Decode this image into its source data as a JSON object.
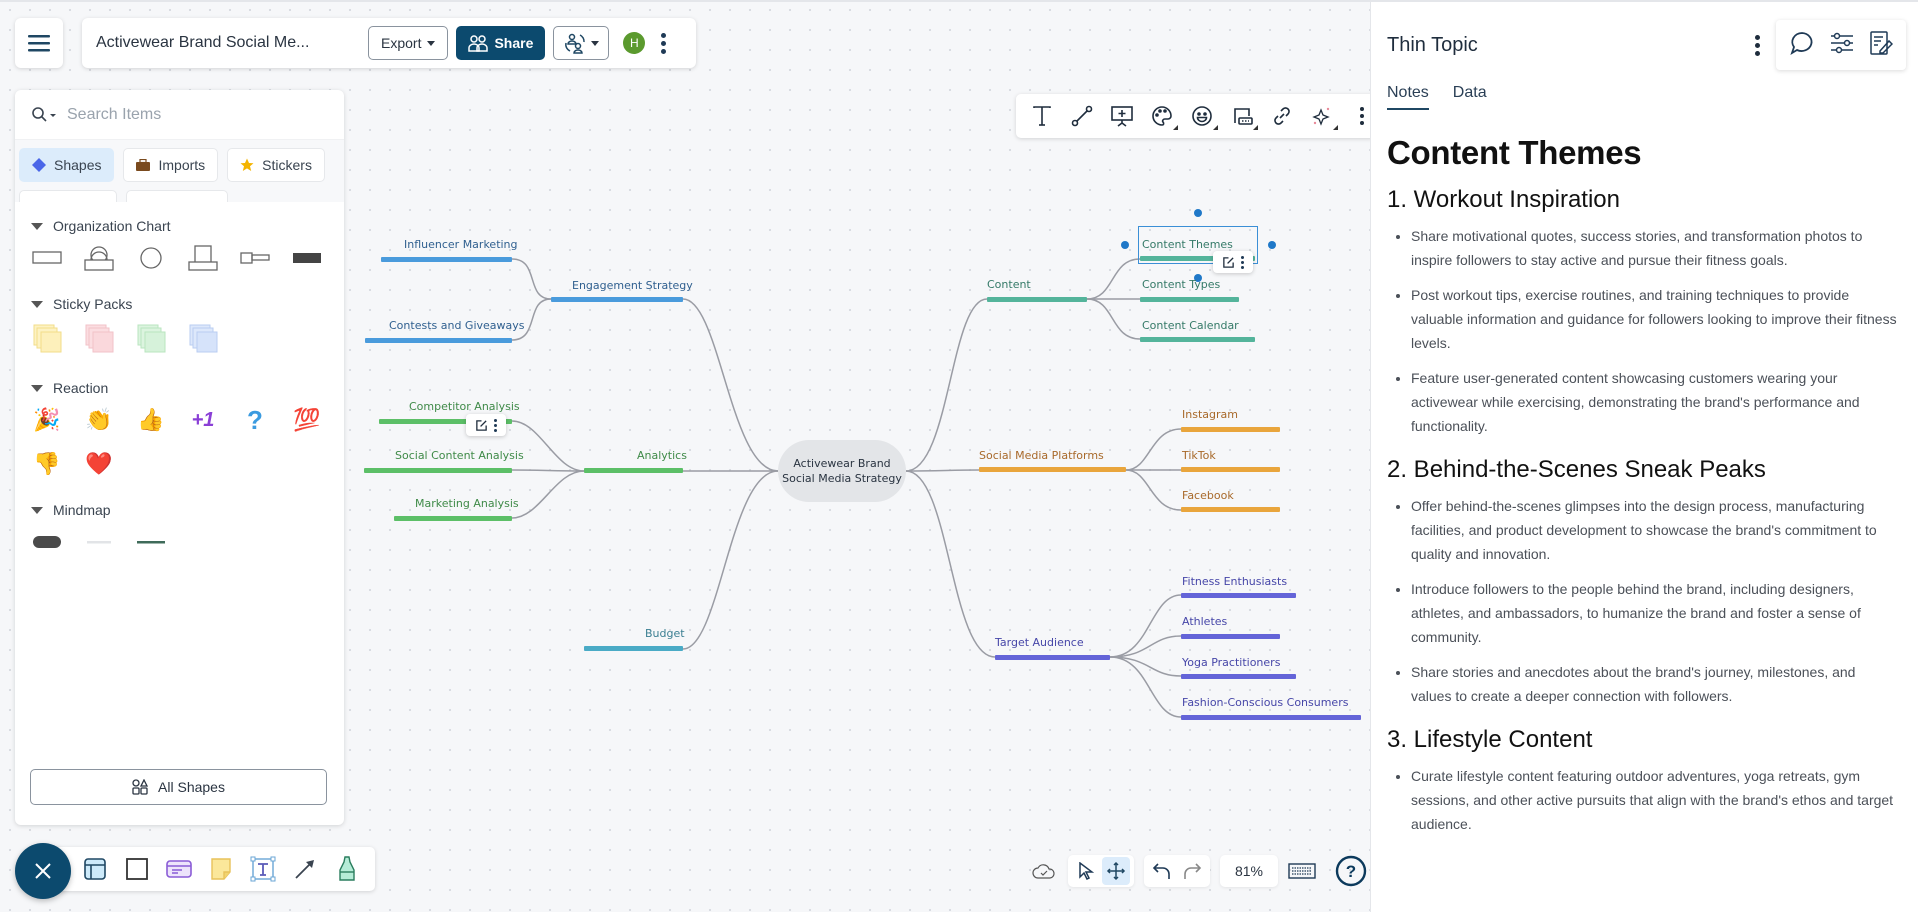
{
  "header": {
    "menu_icon": "hamburger-icon",
    "doc_title": "Activewear Brand Social Me...",
    "export_label": "Export",
    "share_label": "Share",
    "avatar_initial": "H",
    "colors": {
      "primary": "#0c4a6e",
      "avatar": "#5b9a2e"
    }
  },
  "shapes_panel": {
    "search_placeholder": "Search Items",
    "tabs": [
      {
        "label": "Shapes",
        "icon": "diamond-icon",
        "active": true
      },
      {
        "label": "Imports",
        "icon": "briefcase-icon",
        "active": false
      },
      {
        "label": "Stickers",
        "icon": "star-icon",
        "active": false
      }
    ],
    "sections": [
      {
        "title": "Organization Chart",
        "items": [
          "rectangle",
          "person-card",
          "circle",
          "photo-card",
          "label-bar",
          "filled-bar"
        ]
      },
      {
        "title": "Sticky Packs",
        "items": [
          "yellow-pack",
          "pink-pack",
          "green-pack",
          "blue-pack"
        ]
      },
      {
        "title": "Reaction",
        "items": [
          "🎉",
          "👏",
          "👍",
          "+1",
          "❓",
          "💯",
          "👎",
          "❤️"
        ]
      },
      {
        "title": "Mindmap",
        "items": [
          "pill-topic",
          "thin-topic-light",
          "thin-topic-dark"
        ]
      }
    ],
    "all_shapes_label": "All Shapes"
  },
  "canvas_toolbar": {
    "tools": [
      "text",
      "connector",
      "presentation",
      "color-palette",
      "emoji",
      "embed",
      "link",
      "ai-sparkle",
      "more"
    ]
  },
  "create_bar": {
    "tools": [
      "container",
      "rectangle",
      "card",
      "sticky-note",
      "text-box",
      "arrow",
      "highlighter"
    ]
  },
  "bottom_controls": {
    "zoom_level": "81%"
  },
  "mindmap": {
    "root": {
      "line1": "Activewear Brand",
      "line2": "Social Media Strategy"
    },
    "branches": [
      {
        "label": "Engagement Strategy",
        "color": "#4a9bdc",
        "children": [
          "Influencer Marketing",
          "Contests and Giveaways"
        ]
      },
      {
        "label": "Analytics",
        "color": "#5cbf67",
        "children": [
          "Competitor Analysis",
          "Social Content Analysis",
          "Marketing Analysis"
        ]
      },
      {
        "label": "Budget",
        "color": "#4aabc6",
        "children": []
      },
      {
        "label": "Content",
        "color": "#54b49b",
        "children": [
          "Content Themes",
          "Content Types",
          "Content Calendar"
        ]
      },
      {
        "label": "Social Media Platforms",
        "color": "#e9a53c",
        "children": [
          "Instagram",
          "TikTok",
          "Facebook"
        ]
      },
      {
        "label": "Target Audience",
        "color": "#6464d8",
        "children": [
          "Fitness Enthusiasts",
          "Athletes",
          "Yoga Practitioners",
          "Fashion-Conscious Consumers"
        ]
      }
    ],
    "selected_node": "Content Themes"
  },
  "right_panel": {
    "title": "Thin Topic",
    "tabs": [
      {
        "label": "Notes",
        "active": true
      },
      {
        "label": "Data",
        "active": false
      }
    ],
    "notes": {
      "heading": "Content Themes",
      "sections": [
        {
          "title": "1. Workout Inspiration",
          "bullets": [
            "Share motivational quotes, success stories, and transformation photos to inspire followers to stay active and pursue their fitness goals.",
            "Post workout tips, exercise routines, and training techniques to provide valuable information and guidance for followers looking to improve their fitness levels.",
            "Feature user-generated content showcasing customers wearing your activewear while exercising, demonstrating the brand's performance and functionality."
          ]
        },
        {
          "title": "2. Behind-the-Scenes Sneak Peaks",
          "bullets": [
            "Offer behind-the-scenes glimpses into the design process, manufacturing facilities, and product development to showcase the brand's commitment to quality and innovation.",
            "Introduce followers to the people behind the brand, including designers, athletes, and ambassadors, to humanize the brand and foster a sense of community.",
            "Share stories and anecdotes about the brand's journey, milestones, and values to create a deeper connection with followers."
          ]
        },
        {
          "title": "3. Lifestyle Content",
          "bullets": [
            "Curate lifestyle content featuring outdoor adventures, yoga retreats, gym sessions, and other active pursuits that align with the brand's ethos and target audience."
          ]
        }
      ]
    }
  }
}
